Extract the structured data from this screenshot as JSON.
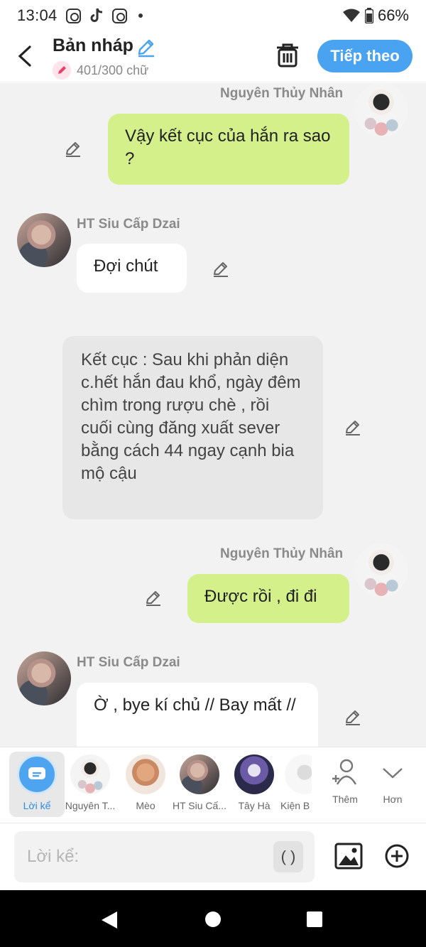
{
  "status_bar": {
    "time": "13:04",
    "battery": "66%"
  },
  "header": {
    "title": "Bản nháp",
    "count": "401/300 chữ",
    "next_label": "Tiếp theo"
  },
  "messages": [
    {
      "sender": "Nguyên Thủy Nhân",
      "text": "Vậy kết cục của hắn ra sao ?"
    },
    {
      "sender": "HT Siu Cấp Dzai",
      "text": "Đợi chút"
    },
    {
      "sender": "",
      "text": "Kết cục : Sau khi phản diện c.hết hắn đau khổ, ngày đêm chìm trong rượu chè , rồi cuối cùng đăng xuất sever bằng cách 44 ngay cạnh bia mộ cậu"
    },
    {
      "sender": "Nguyên Thủy Nhân",
      "text": "Được rồi , đi đi"
    },
    {
      "sender": "HT Siu Cấp Dzai",
      "text": "Ờ , bye kí chủ // Bay mất //"
    }
  ],
  "characters": [
    "Lời kể",
    "Nguyên T...",
    "Mèo",
    "HT Siu Cấ...",
    "Tây Hà",
    "Kiện B",
    "Thêm",
    "Hơn"
  ],
  "input": {
    "placeholder": "Lời kể:",
    "paren": "( )"
  }
}
